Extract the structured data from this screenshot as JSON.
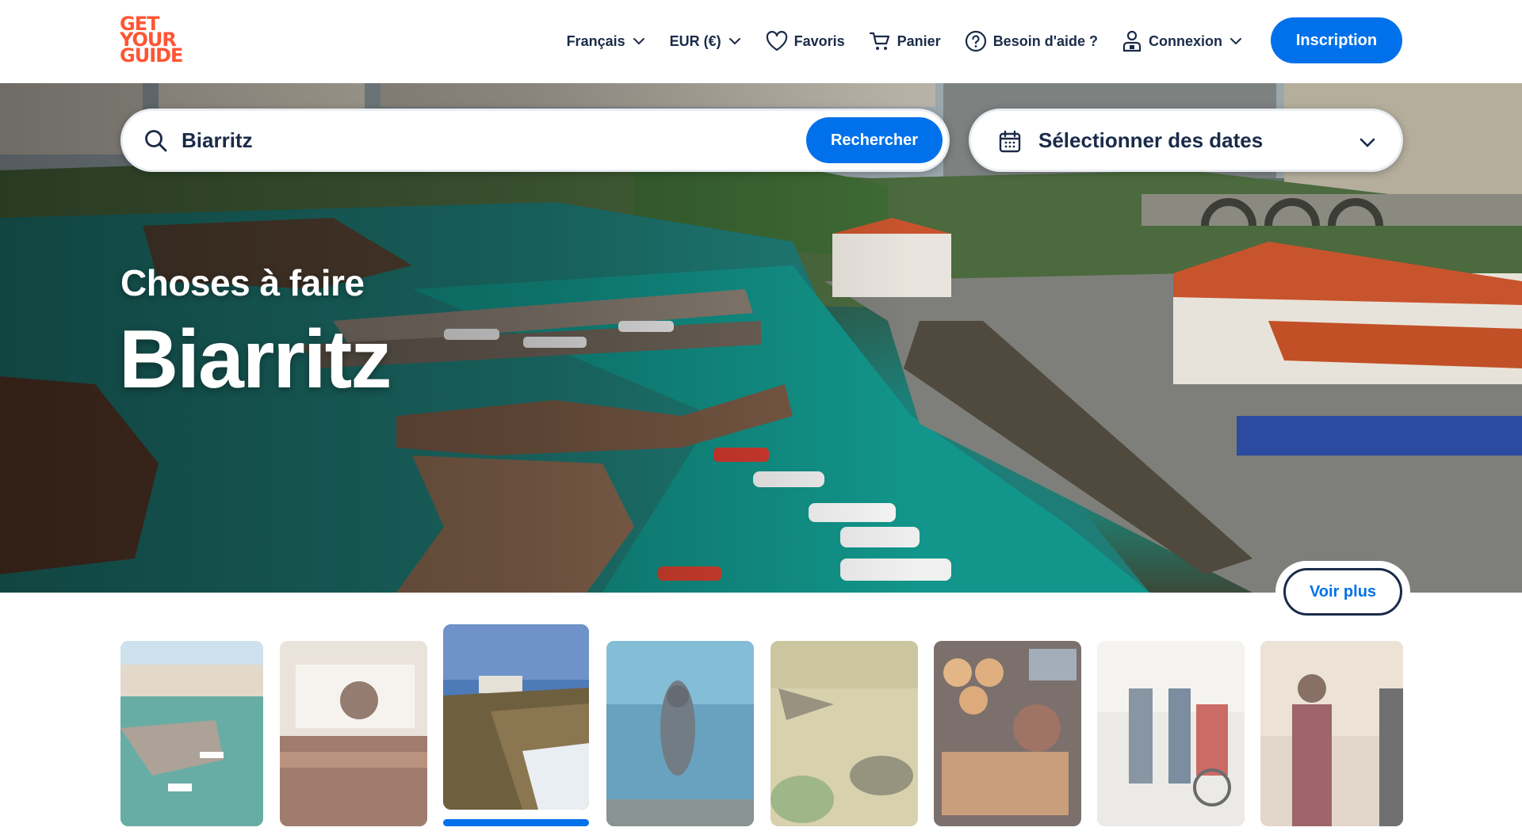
{
  "brand": {
    "logo_lines": [
      "GET",
      "YOUR",
      "GUIDE"
    ],
    "accent_color": "#ff5533",
    "primary_color": "#0071eb",
    "text_color": "#1a2b49"
  },
  "header": {
    "nav": [
      {
        "label": "Français",
        "icon": "chevron-down-icon"
      },
      {
        "label": "EUR (€)",
        "icon": "chevron-down-icon"
      },
      {
        "label": "Favoris",
        "icon": "heart-icon"
      },
      {
        "label": "Panier",
        "icon": "cart-icon"
      },
      {
        "label": "Besoin d'aide ?",
        "icon": "help-circle-icon"
      },
      {
        "label": "Connexion",
        "icon": "user-lock-icon"
      }
    ],
    "signup_label": "Inscription"
  },
  "search": {
    "value": "Biarritz",
    "button_label": "Rechercher"
  },
  "dates": {
    "label": "Sélectionner des dates"
  },
  "hero": {
    "subtitle": "Choses à faire",
    "title": "Biarritz",
    "more_label": "Voir plus"
  },
  "gallery": {
    "selected_index": 2,
    "items": [
      {
        "subject": "old-port-aerial"
      },
      {
        "subject": "woman-in-van"
      },
      {
        "subject": "cliffs-and-sea"
      },
      {
        "subject": "snorkeling"
      },
      {
        "subject": "grass-and-turtle"
      },
      {
        "subject": "pastries-market"
      },
      {
        "subject": "friends-walking"
      },
      {
        "subject": "women-in-city"
      }
    ]
  }
}
